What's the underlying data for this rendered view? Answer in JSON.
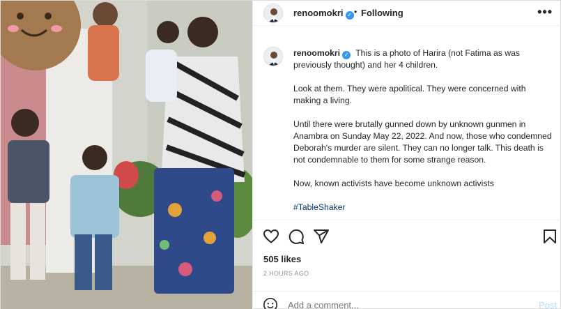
{
  "header": {
    "username": "renoomokri",
    "separator": "•",
    "follow_status": "Following",
    "more_icon": "more-options-icon"
  },
  "caption": {
    "username": "renoomokri",
    "paragraphs": [
      "This is a photo of Harira (not Fatima as was previously thought) and her 4 children.",
      "Look at them. They were apolitical. They were concerned with making a living.",
      "Until there were brutally gunned down by unknown gunmen in Anambra on Sunday May 22, 2022. And now, those who condemned Deborah's murder are silent. They can no longer talk. This death is not condemnable to them for some strange reason.",
      "Now, known activists have become unknown activists"
    ],
    "hashtag": "#TableShaker"
  },
  "actions": {
    "like_icon": "heart-icon",
    "comment_icon": "comment-icon",
    "share_icon": "share-icon",
    "save_icon": "bookmark-icon"
  },
  "likes": "505 likes",
  "timestamp": "2 HOURS AGO",
  "comment": {
    "placeholder": "Add a comment...",
    "post_label": "Post",
    "emoji_icon": "emoji-icon"
  },
  "colors": {
    "verified": "#3897f0",
    "hashtag": "#00376b",
    "post_button": "#b3dbff",
    "muted": "#8e8e8e"
  }
}
